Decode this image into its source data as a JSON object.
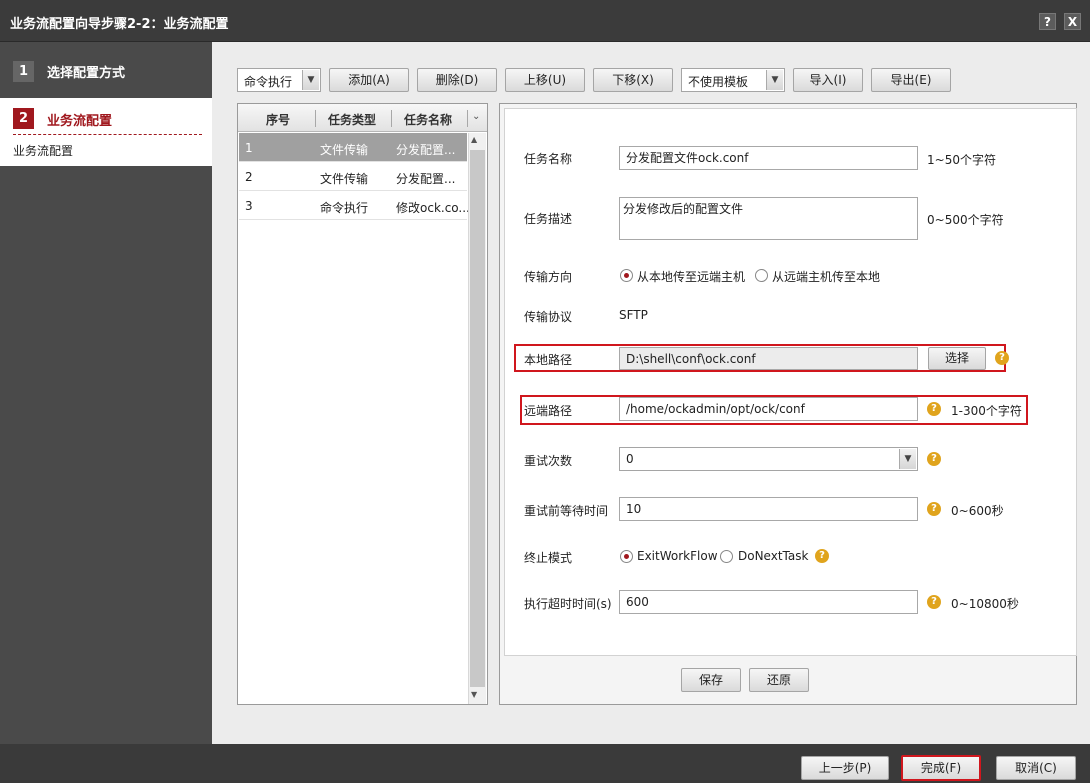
{
  "window": {
    "title": "业务流配置向导步骤2-2：业务流配置",
    "help_glyph": "?",
    "close_glyph": "X"
  },
  "steps": [
    {
      "number": "1",
      "label": "选择配置方式"
    },
    {
      "number": "2",
      "label": "业务流配置",
      "sub": "业务流配置"
    }
  ],
  "toolbar": {
    "type_select": "命令执行",
    "add": "添加(A)",
    "delete": "删除(D)",
    "move_up": "上移(U)",
    "move_down": "下移(X)",
    "template_select": "不使用模板",
    "import": "导入(I)",
    "export": "导出(E)"
  },
  "task_list": {
    "headers": [
      "序号",
      "任务类型",
      "任务名称"
    ],
    "rows": [
      {
        "index": "1",
        "type": "文件传输",
        "name": "分发配置..."
      },
      {
        "index": "2",
        "type": "文件传输",
        "name": "分发配置..."
      },
      {
        "index": "3",
        "type": "命令执行",
        "name": "修改ock.co..."
      }
    ]
  },
  "form": {
    "task_name_label": "任务名称",
    "task_name_value": "分发配置文件ock.conf",
    "task_name_hint": "1~50个字符",
    "task_desc_label": "任务描述",
    "task_desc_value": "分发修改后的配置文件",
    "task_desc_hint": "0~500个字符",
    "direction_label": "传输方向",
    "direction_opt1": "从本地传至远端主机",
    "direction_opt2": "从远端主机传至本地",
    "protocol_label": "传输协议",
    "protocol_value": "SFTP",
    "local_path_label": "本地路径",
    "local_path_value": "D:\\shell\\conf\\ock.conf",
    "select_button": "选择",
    "remote_path_label": "远端路径",
    "remote_path_value": "/home/ockadmin/opt/ock/conf",
    "remote_path_hint": "1-300个字符",
    "retry_label": "重试次数",
    "retry_value": "0",
    "retry_wait_label": "重试前等待时间",
    "retry_wait_value": "10",
    "retry_wait_hint": "0~600秒",
    "stop_mode_label": "终止模式",
    "stop_opt1": "ExitWorkFlow",
    "stop_opt2": "DoNextTask",
    "timeout_label": "执行超时时间(s)",
    "timeout_value": "600",
    "timeout_hint": "0~10800秒",
    "save_button": "保存",
    "restore_button": "还原",
    "help_glyph": "?"
  },
  "footer": {
    "prev": "上一步(P)",
    "finish": "完成(F)",
    "cancel": "取消(C)"
  },
  "colors": {
    "accent": "#a0181e",
    "highlight_box": "#d0161d",
    "help_icon": "#e0a41d"
  }
}
